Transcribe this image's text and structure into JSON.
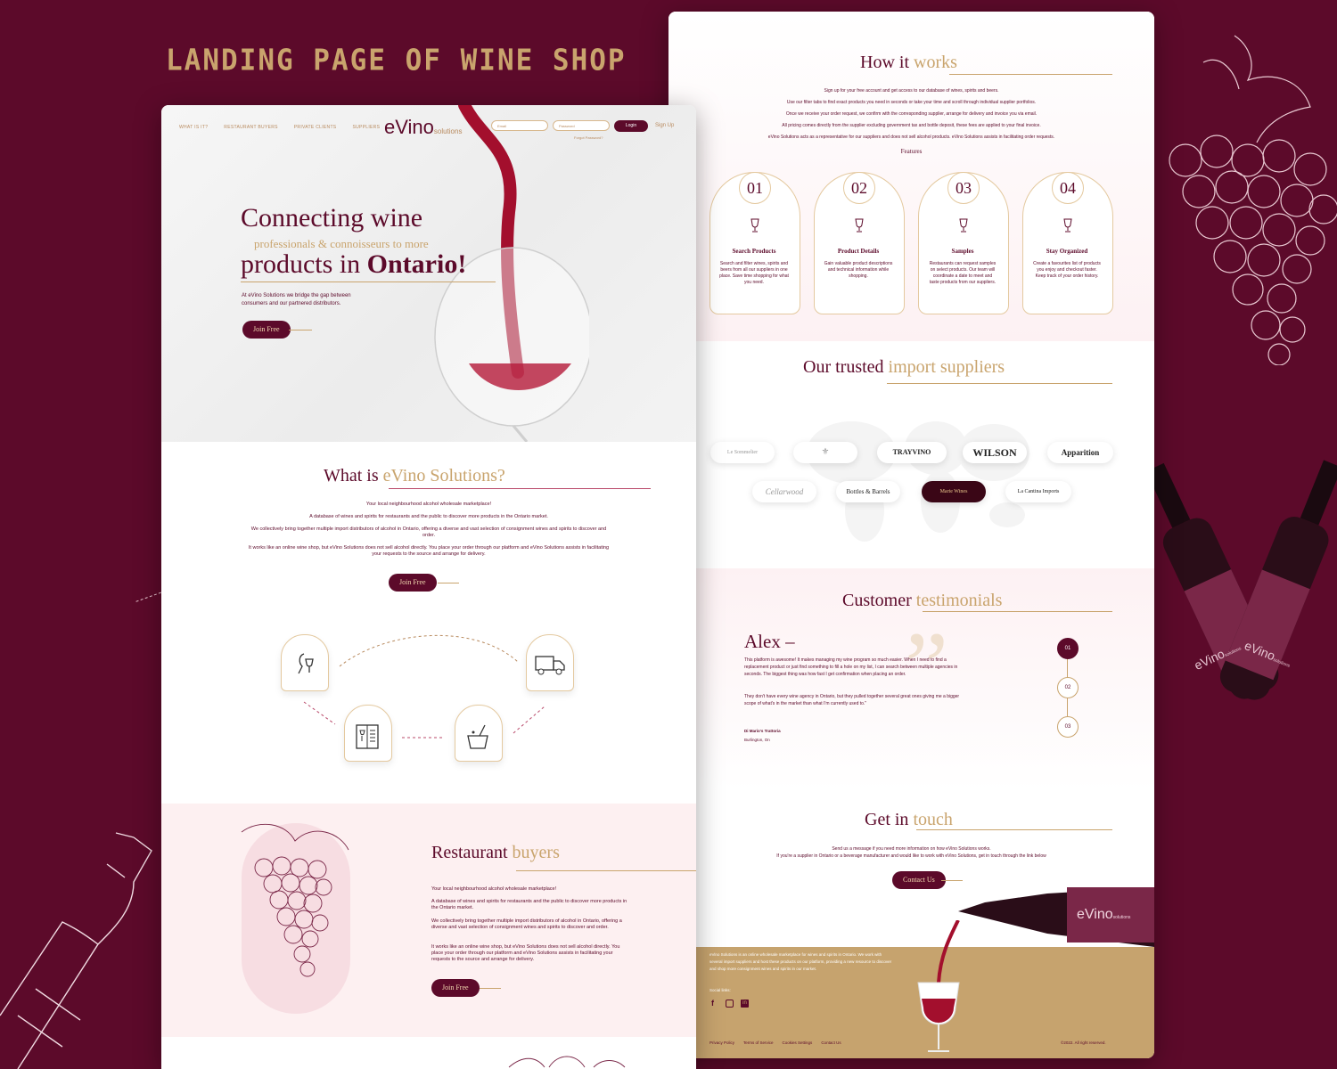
{
  "poster": {
    "title": "LANDING PAGE OF WINE SHOP"
  },
  "colors": {
    "burgundy": "#5c0a2a",
    "gold": "#c9a46d",
    "pink": "#fdf0f1"
  },
  "left": {
    "nav": [
      "WHAT IS IT?",
      "RESTAURANT BUYERS",
      "PRIVATE CLIENTS",
      "SUPPLIERS"
    ],
    "logo": {
      "main": "eVino",
      "sub": "solutions"
    },
    "login": {
      "email_placeholder": "Email",
      "password_placeholder": "Password",
      "login_label": "Login",
      "signup_label": "Sign Up",
      "forgot": "Forgot Password?"
    },
    "hero": {
      "line1": "Connecting wine",
      "sub": "professionals & connoisseurs to more",
      "line2a": "products in ",
      "line2b": "Ontario!",
      "paragraph": "At eVino Solutions we bridge the gap between consumers and our partnered distributors.",
      "cta": "Join Free"
    },
    "what": {
      "title_a": "What is ",
      "title_b": "eVino Solutions?",
      "p1": "Your local neighbourhood alcohol wholesale marketplace!",
      "p2": "A database of wines and spirits for restaurants and the public to discover more products in the Ontario market.",
      "p3": "We collectively bring together multiple import distributors of alcohol in Ontario, offering a diverse and vast selection of consignment wines and spirits to discover and order.",
      "p4": "It works like an online wine shop, but eVino Solutions does not sell alcohol directly. You place your order through our platform and eVino Solutions assists in facilitating your requests to the source and arrange for delivery.",
      "cta": "Join Free"
    },
    "restaurant": {
      "title_a": "Restaurant ",
      "title_b": "buyers",
      "p1": "Your local neighbourhood alcohol wholesale marketplace!",
      "p2": "A database of wines and spirits for restaurants and the public to discover more products in the Ontario market.",
      "p3": "We collectively bring together multiple import distributors of alcohol in Ontario, offering a diverse and vast selection of consignment wines and spirits to discover and order.",
      "p4": "It works like an online wine shop, but eVino Solutions does not sell alcohol directly. You place your order through our platform and eVino Solutions assists in facilitating your requests to the source and arrange for delivery.",
      "cta": "Join Free"
    }
  },
  "right": {
    "how": {
      "title_a": "How it ",
      "title_b": "works",
      "lines": [
        "Sign up for your free account and get access to our database of wines, spirits and beers.",
        "Use our filter tabs to find exact products you need in seconds or take your time and scroll through individual supplier portfolios.",
        "Once we receive your order request, we confirm with the corresponding supplier, arrange for delivery and invoice you via email.",
        "All pricing comes directly from the supplier excluding government tax and bottle deposit, these fees are applied to your final invoice.",
        "eVino Solutions acts as a representative for our suppliers and does not sell alcohol products. eVino Solutions assists in facilitating order requests."
      ],
      "features_label": "Features"
    },
    "features": [
      {
        "num": "01",
        "title": "Search Products",
        "text": "Search and filter wines, spirits and beers from all our suppliers in one place. Save time shopping for what you need."
      },
      {
        "num": "02",
        "title": "Product Details",
        "text": "Gain valuable product descriptions and technical information while shopping."
      },
      {
        "num": "03",
        "title": "Samples",
        "text": "Restaurants can request samples on select products. Our team will coordinate a date to meet and taste products from our suppliers."
      },
      {
        "num": "04",
        "title": "Stay Organized",
        "text": "Create a favourites list of products you enjoy and checkout faster. Keep track of your order history."
      }
    ],
    "suppliers": {
      "title_a": "Our trusted ",
      "title_b": "import suppliers",
      "row1": [
        "Le Sommelier",
        "",
        "TRAYVINO",
        "WILSON",
        "Apparition"
      ],
      "row2": [
        "Cellarwood",
        "Bottles & Barrels",
        "Marie Wines",
        "La Cantina Imports"
      ]
    },
    "testimonials": {
      "title_a": "Customer ",
      "title_b": "testimonials",
      "name": "Alex –",
      "p1": "This platform is awesome! It makes managing my wine program so much easier. When I need to find a replacement product or just find something to fill a hole on my list, I can search between multiple agencies in seconds. The biggest thing was how fast I get confirmation when placing an order.",
      "p2": "They don't have every wine agency in Ontario, but they pulled together several great ones giving me a bigger scope of what's in the market than what I'm currently used to.\"",
      "author": "Di Mario's Trattoria",
      "location": "Burlington, On",
      "steps": [
        "01",
        "02",
        "03"
      ]
    },
    "contact": {
      "title_a": "Get in ",
      "title_b": "touch",
      "p1": "Send us a message if you need more information on how eVino Solutions works.",
      "p2": "If you're a supplier in Ontario or a beverage manufacturer and would like to work with eVino Solutions, get in touch through the link below",
      "cta": "Contact Us"
    },
    "footer": {
      "about": "eVino Solutions is an online wholesale marketplace for wines and spirits in Ontario. We work with several import suppliers and host these products on our platform, providing a new resource to discover and shop more consignment wines and spirits in our market.",
      "social_label": "Social links:",
      "links": [
        "Privacy Policy",
        "Terms of Service",
        "Cookies Settings",
        "Contact Us"
      ],
      "copyright": "©2022. All right reserved.",
      "bottle_label": "eVino",
      "bottle_sub": "solutions"
    }
  },
  "bottles": {
    "label": "eVino",
    "sub": "solutions"
  }
}
